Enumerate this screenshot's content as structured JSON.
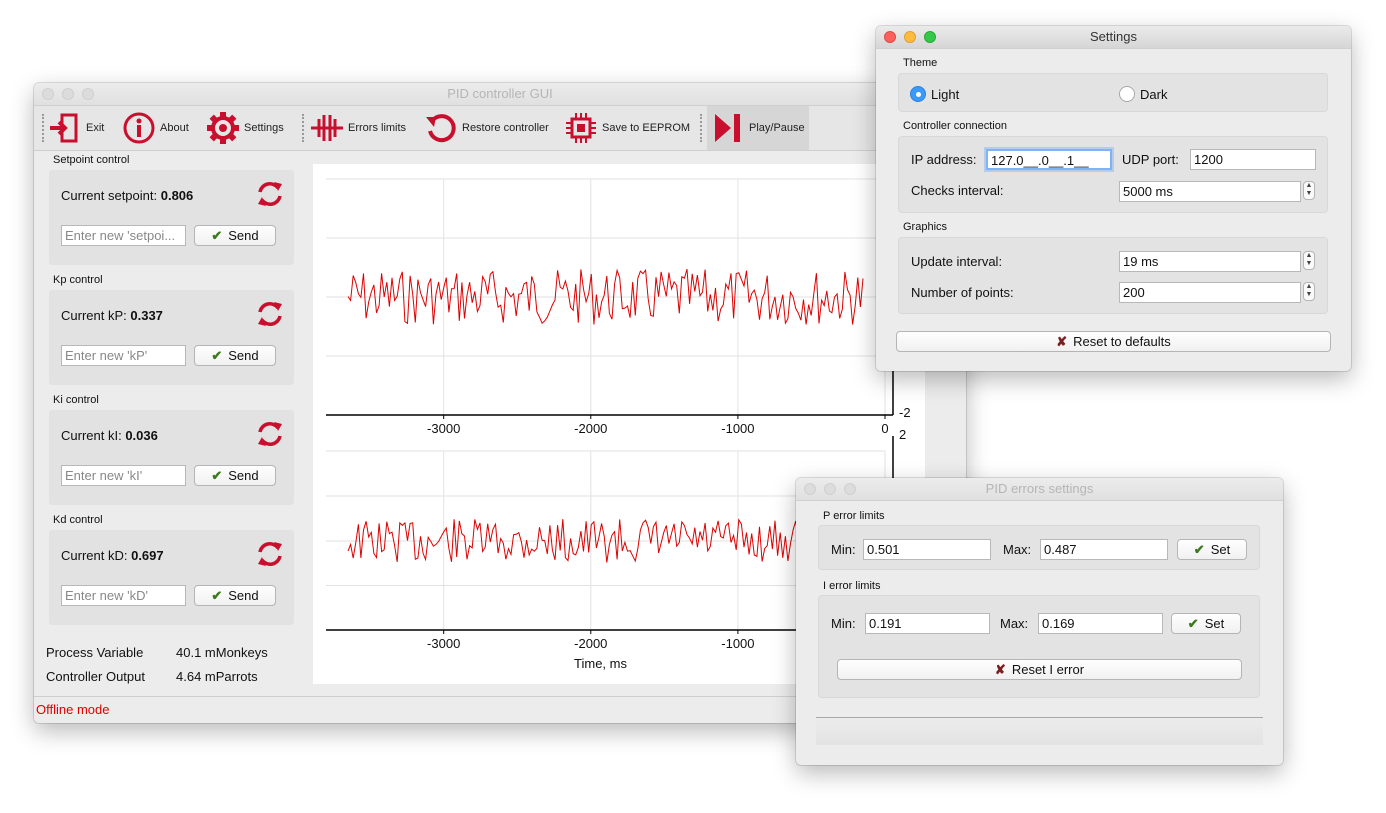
{
  "main": {
    "title": "PID controller GUI",
    "toolbar": {
      "exit": "Exit",
      "about": "About",
      "settings": "Settings",
      "errors_limits": "Errors limits",
      "restore": "Restore controller",
      "save_eeprom": "Save to EEPROM",
      "play_pause": "Play/Pause"
    },
    "setpoint": {
      "section": "Setpoint control",
      "label": "Current setpoint:",
      "value": "0.806",
      "placeholder": "Enter new 'setpoi...",
      "send": "Send"
    },
    "kp": {
      "section": "Kp control",
      "label": "Current kP:",
      "value": "0.337",
      "placeholder": "Enter new 'kP'",
      "send": "Send"
    },
    "ki": {
      "section": "Ki control",
      "label": "Current kI:",
      "value": "0.036",
      "placeholder": "Enter new 'kI'",
      "send": "Send"
    },
    "kd": {
      "section": "Kd control",
      "label": "Current kD:",
      "value": "0.697",
      "placeholder": "Enter new 'kD'",
      "send": "Send"
    },
    "process_variable": {
      "label": "Process Variable",
      "value": "40.1 mMonkeys"
    },
    "controller_output": {
      "label": "Controller Output",
      "value": "4.64 mParrots"
    },
    "status": "Offline mode"
  },
  "chart_data": [
    {
      "type": "line",
      "series": [
        {
          "values_description": "",
          "color": "#dd0000"
        }
      ],
      "x_ticks": [
        "-3000",
        "-2000",
        "-1000",
        "0"
      ],
      "y_ticks_visible": [
        "-2"
      ],
      "xlim": [
        -3800,
        0
      ]
    },
    {
      "type": "line",
      "series": [
        {
          "color": "#dd0000"
        }
      ],
      "x_ticks": [
        "-3000",
        "-2000",
        "-1000"
      ],
      "y_ticks_visible": [
        "2"
      ],
      "xlabel": "Time, ms",
      "xlim": [
        -3800,
        0
      ]
    }
  ],
  "settings": {
    "title": "Settings",
    "theme": {
      "section": "Theme",
      "light": "Light",
      "dark": "Dark",
      "selected": "Light"
    },
    "connection": {
      "section": "Controller connection",
      "ip_label": "IP address:",
      "ip_value": "127.0__.0__.1__",
      "udp_label": "UDP port:",
      "udp_value": "1200",
      "checks_label": "Checks interval:",
      "checks_value": "5000 ms"
    },
    "graphics": {
      "section": "Graphics",
      "update_label": "Update interval:",
      "update_value": "19 ms",
      "points_label": "Number of points:",
      "points_value": "200"
    },
    "reset": "Reset to defaults"
  },
  "errors": {
    "title": "PID errors settings",
    "p": {
      "section": "P error limits",
      "min_label": "Min:",
      "min_value": "0.501",
      "max_label": "Max:",
      "max_value": "0.487",
      "set": "Set"
    },
    "i": {
      "section": "I error limits",
      "min_label": "Min:",
      "min_value": "0.191",
      "max_label": "Max:",
      "max_value": "0.169",
      "set": "Set"
    },
    "reset_i": "Reset I error"
  }
}
